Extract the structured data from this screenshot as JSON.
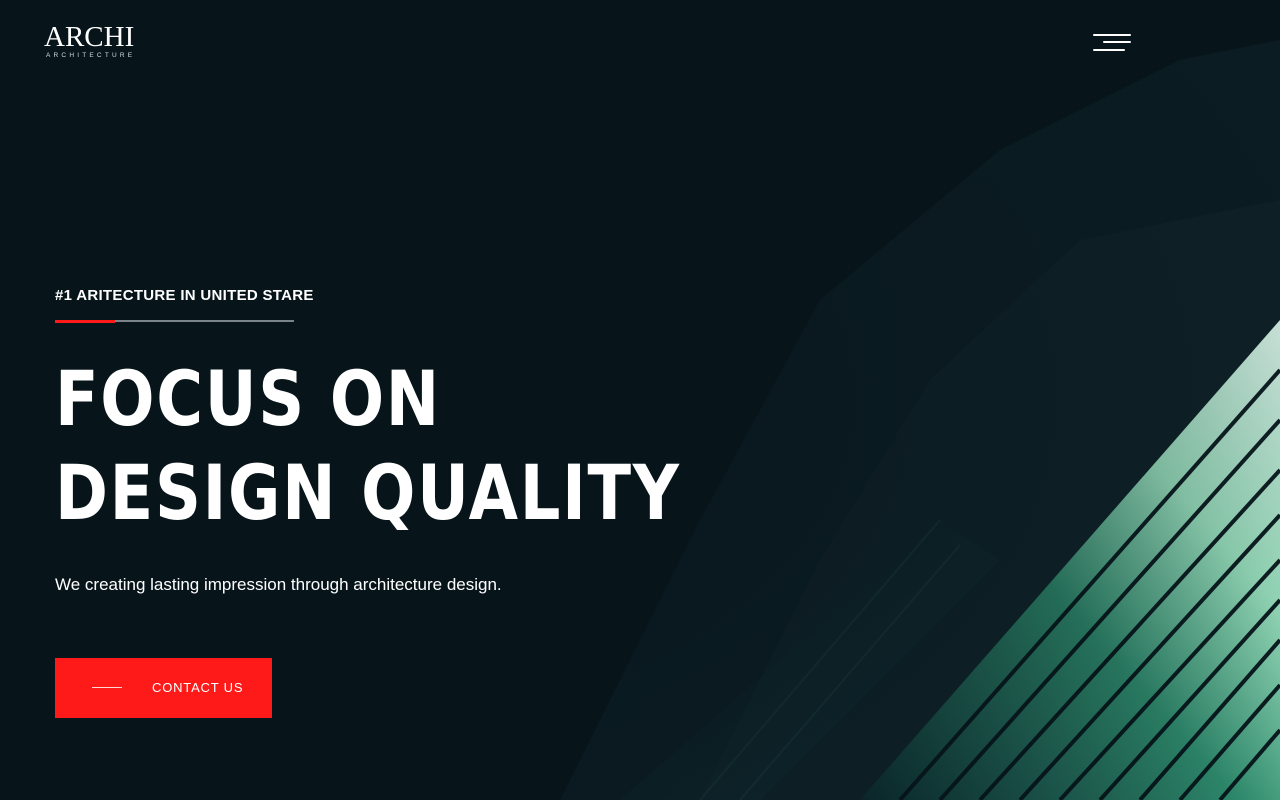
{
  "brand": {
    "name": "ARCHI",
    "tagline": "ARCHITECTURE"
  },
  "header": {
    "menu_icon": "hamburger-menu-icon"
  },
  "hero": {
    "kicker": "#1 ARITECTURE IN UNITED STARE",
    "headline_line1": "FOCUS ON",
    "headline_line2": "DESIGN QUALITY",
    "subtitle": "We creating lasting impression through architecture design.",
    "cta_label": "CONTACT US",
    "cta_icon": "line-dash-icon"
  },
  "colors": {
    "background": "#07151b",
    "accent": "#ff1a1a",
    "text": "#ffffff",
    "building_glass": "#7fe0b0"
  }
}
